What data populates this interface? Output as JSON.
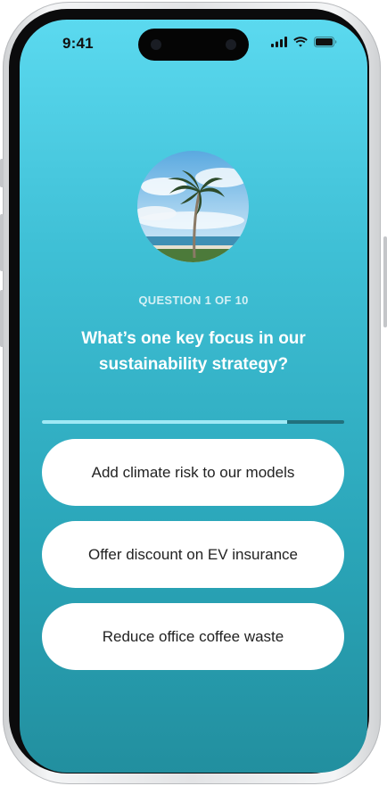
{
  "status_bar": {
    "time": "9:41",
    "icons": [
      "signal-icon",
      "wifi-icon",
      "battery-icon"
    ]
  },
  "quiz": {
    "image": "palm-tree-photo",
    "counter": "QUESTION 1 OF 10",
    "question": "What’s one key focus in our sustainability strategy?",
    "progress": 0.81,
    "answers": [
      "Add climate risk to our models",
      "Offer discount on EV insurance",
      "Reduce office coffee waste"
    ]
  },
  "colors": {
    "gradient_top": "#5bd9ef",
    "gradient_bottom": "#228f9f",
    "answer_bg": "#ffffff",
    "progress_fill": "#9fe9f5"
  }
}
